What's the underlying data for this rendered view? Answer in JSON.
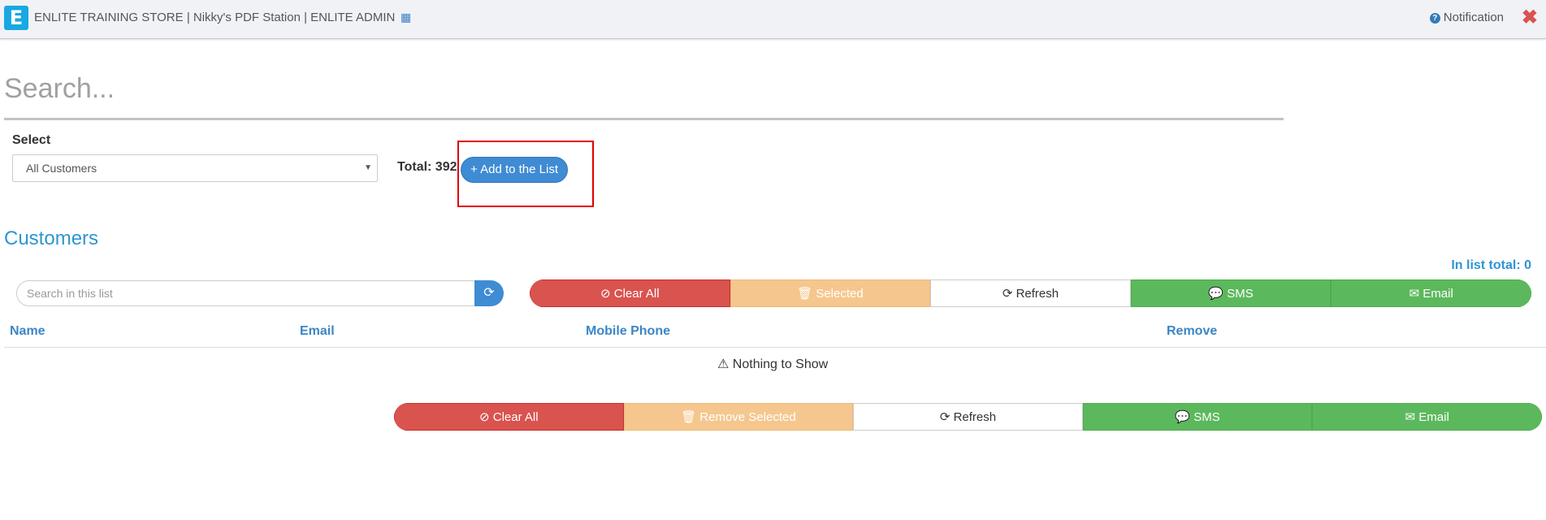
{
  "header": {
    "title": "ENLITE TRAINING STORE | Nikky's PDF Station | ENLITE ADMIN",
    "notification_label": "Notification",
    "logo_letter": "E"
  },
  "search": {
    "placeholder": "Search..."
  },
  "filter": {
    "label": "Select",
    "selected": "All Customers",
    "total": "Total: 392",
    "add_button": "+ Add to the List"
  },
  "customers": {
    "title": "Customers",
    "in_list_total": "In list total: 0",
    "search_placeholder": "Search in this list",
    "top_actions": {
      "clear_all": "⊘ Clear All",
      "selected": "🗑 Selected",
      "refresh": "⟳ Refresh",
      "sms": "💬 SMS",
      "email": "✉ Email"
    },
    "columns": [
      "Name",
      "Email",
      "Mobile Phone",
      "Remove"
    ],
    "empty_message": "⚠ Nothing to Show",
    "bottom_actions": {
      "clear_all": "⊘ Clear All",
      "remove_selected": "🗑 Remove Selected",
      "refresh": "⟳ Refresh",
      "sms": "💬 SMS",
      "email": "✉ Email"
    }
  },
  "colors": {
    "primary": "#3f8bd4",
    "danger": "#d9534f",
    "warning": "#f5c78e",
    "success": "#5cb85c",
    "accent_text": "#2e95d3"
  }
}
